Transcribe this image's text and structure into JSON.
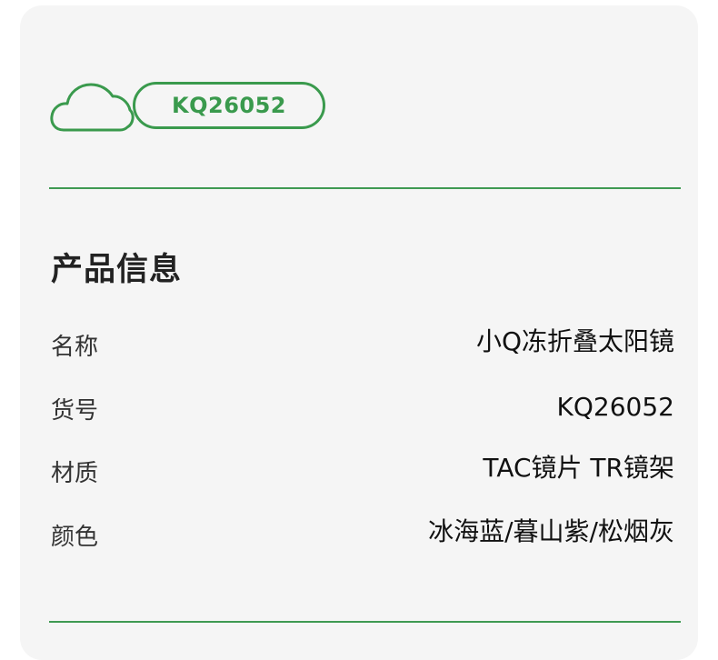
{
  "product_card": {
    "code_badge": "KQ26052",
    "section_title": "产品信息",
    "info_rows": [
      {
        "label": "名称",
        "value": "小Q冻折叠太阳镜"
      },
      {
        "label": "货号",
        "value": "KQ26052"
      },
      {
        "label": "材质",
        "value": "TAC镜片 TR镜架"
      },
      {
        "label": "颜色",
        "value": "冰海蓝/暮山紫/松烟灰"
      }
    ]
  },
  "colors": {
    "accent_green": "#3a9a4d",
    "card_background": "#f5f5f5",
    "text_dark": "#222222"
  },
  "icons": {
    "cloud": "cloud-icon"
  }
}
